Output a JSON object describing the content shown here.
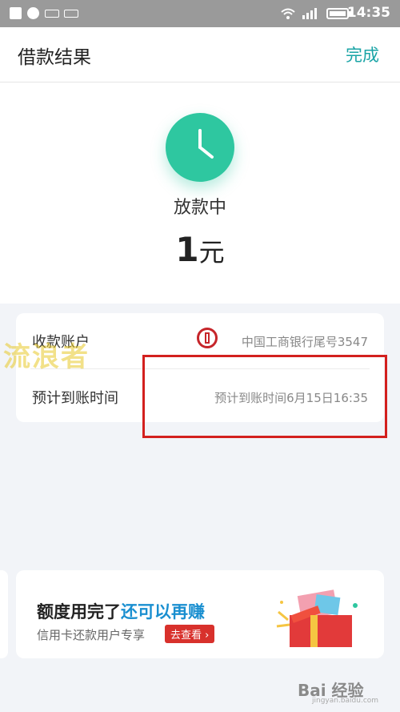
{
  "status_bar": {
    "time": "14:35"
  },
  "header": {
    "title": "借款结果",
    "done_label": "完成"
  },
  "result": {
    "status": "放款中",
    "amount_number": "1",
    "amount_unit": "元"
  },
  "info": {
    "rows": [
      {
        "label": "收款账户",
        "value": "中国工商银行尾号3547"
      },
      {
        "label": "预计到账时间",
        "value": "预计到账时间6月15日16:35"
      }
    ]
  },
  "watermark": "流浪者",
  "promo": {
    "title_part1": "额度用完了",
    "title_part2": "还可以再赚",
    "subtitle": "信用卡还款用户专享",
    "button_label": "去查看 ›"
  },
  "footer": {
    "logo_text": "Bai 经验",
    "url": "jingyan.baidu.com"
  },
  "colors": {
    "accent": "#1aa4a6",
    "clock": "#2ec7a0",
    "highlight": "#d3201e",
    "promo_highlight": "#1a8fd0"
  }
}
